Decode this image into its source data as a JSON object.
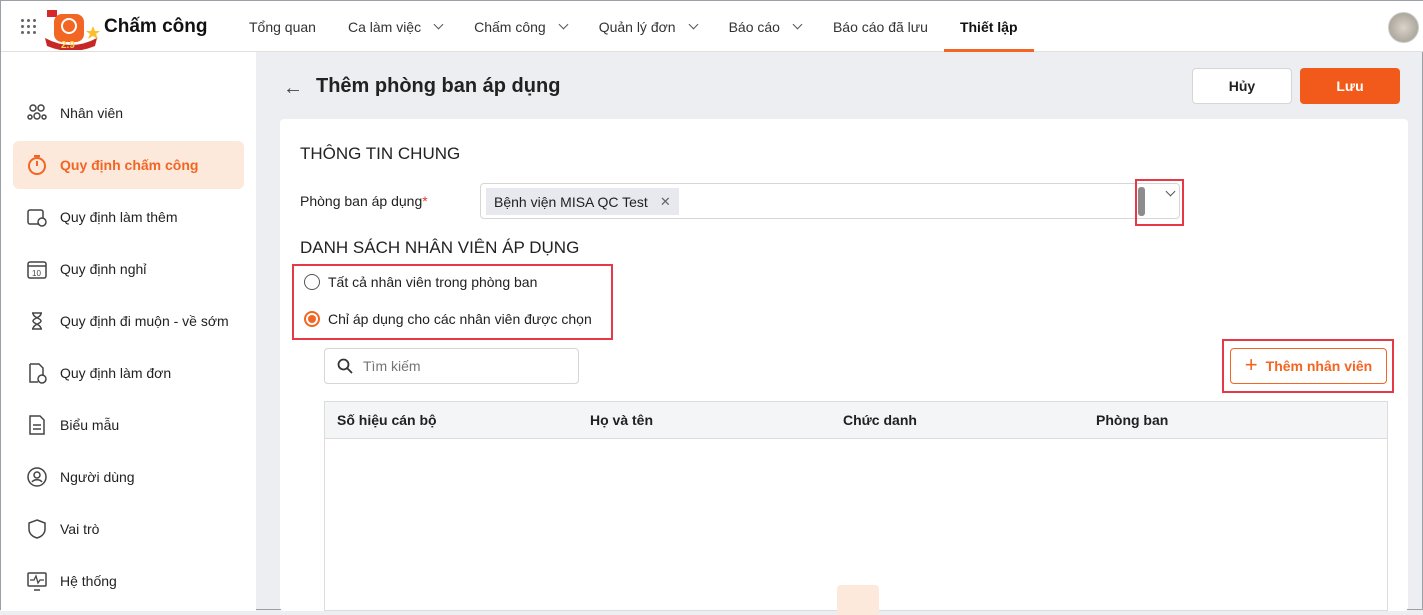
{
  "app": {
    "name": "Chấm công"
  },
  "nav": [
    {
      "label": "Tổng quan",
      "dd": false
    },
    {
      "label": "Ca làm việc",
      "dd": true
    },
    {
      "label": "Chấm công",
      "dd": true
    },
    {
      "label": "Quản lý đơn",
      "dd": true
    },
    {
      "label": "Báo cáo",
      "dd": true
    },
    {
      "label": "Báo cáo đã lưu",
      "dd": false
    },
    {
      "label": "Thiết lập",
      "dd": false,
      "active": true
    }
  ],
  "sidebar": [
    {
      "label": "Nhân viên",
      "icon": "people-icon"
    },
    {
      "label": "Quy định chấm công",
      "icon": "timer-icon",
      "active": true
    },
    {
      "label": "Quy định làm thêm",
      "icon": "calendar-clock-icon"
    },
    {
      "label": "Quy định nghỉ",
      "icon": "calendar-icon"
    },
    {
      "label": "Quy định đi muộn - về sớm",
      "icon": "hourglass-icon"
    },
    {
      "label": "Quy định làm đơn",
      "icon": "document-clock-icon"
    },
    {
      "label": "Biểu mẫu",
      "icon": "form-icon"
    },
    {
      "label": "Người dùng",
      "icon": "user-icon"
    },
    {
      "label": "Vai trò",
      "icon": "shield-icon"
    },
    {
      "label": "Hệ thống",
      "icon": "monitor-icon"
    }
  ],
  "page": {
    "title": "Thêm phòng ban áp dụng",
    "cancel": "Hủy",
    "save": "Lưu"
  },
  "form": {
    "section1": "THÔNG TIN CHUNG",
    "dept_label": "Phòng ban áp dụng",
    "required": "*",
    "dept_tag": "Bệnh viện MISA QC Test",
    "section2": "DANH SÁCH NHÂN VIÊN ÁP DỤNG",
    "radio_all": "Tất cả nhân viên trong phòng ban",
    "radio_selected": "Chỉ áp dụng cho các nhân viên được chọn",
    "selected": "radio_selected",
    "search_placeholder": "Tìm kiếm",
    "add_employee": "Thêm nhân viên"
  },
  "table": {
    "columns": [
      "Số hiệu cán bộ",
      "Họ và tên",
      "Chức danh",
      "Phòng ban"
    ],
    "rows": []
  },
  "colors": {
    "accent": "#f26522",
    "highlight": "#e53945"
  }
}
